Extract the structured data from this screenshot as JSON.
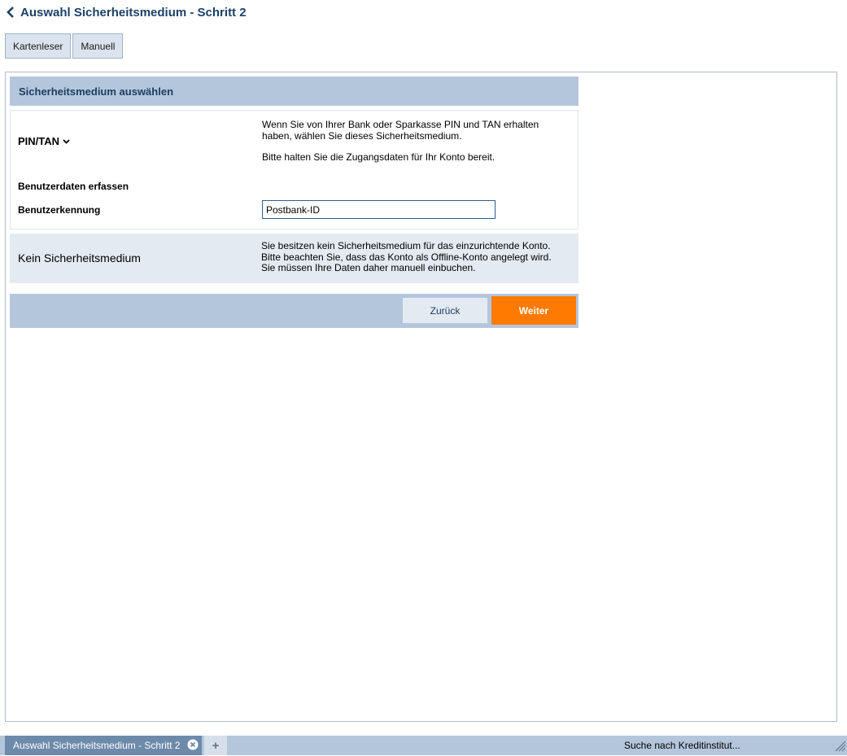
{
  "header": {
    "title": "Auswahl Sicherheitsmedium - Schritt 2"
  },
  "tabs": [
    {
      "label": "Kartenleser"
    },
    {
      "label": "Manuell"
    }
  ],
  "section": {
    "title": "Sicherheitsmedium auswählen"
  },
  "pintan": {
    "label": "PIN/TAN",
    "desc1": "Wenn Sie von Ihrer Bank oder Sparkasse PIN und TAN erhalten haben, wählen Sie dieses Sicherheitsmedium.",
    "desc2": "Bitte halten Sie die Zugangsdaten für Ihr Konto bereit.",
    "user_data_heading": "Benutzerdaten erfassen",
    "user_id_label": "Benutzerkennung",
    "user_id_value": "Postbank-ID"
  },
  "no_medium": {
    "label": "Kein Sicherheitsmedium",
    "desc_lines": [
      "Sie besitzen kein Sicherheitsmedium für das einzurichtende Konto.",
      "Bitte beachten Sie, dass das Konto als Offline-Konto angelegt wird.",
      "Sie müssen Ihre Daten daher manuell einbuchen."
    ]
  },
  "actions": {
    "back_label": "Zurück",
    "next_label": "Weiter"
  },
  "statusbar": {
    "tab_label": "Auswahl Sicherheitsmedium - Schritt 2",
    "add_label": "+",
    "status_text": "Suche nach Kreditinstitut..."
  },
  "colors": {
    "accent": "#ff7a00",
    "header_bg": "#b4c6dc",
    "title": "#1d4166"
  }
}
